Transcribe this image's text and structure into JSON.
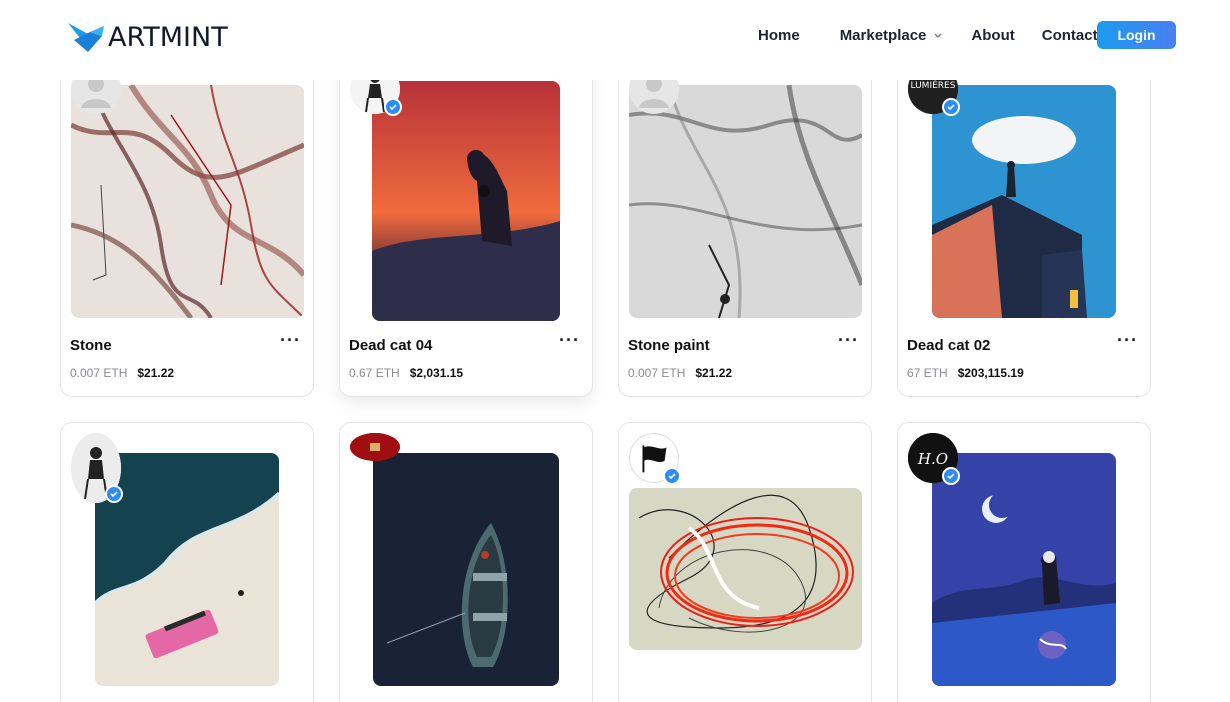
{
  "brand": {
    "name": "ARTMINT",
    "accent": "#1a9bf0"
  },
  "nav": {
    "home": "Home",
    "marketplace": "Marketplace",
    "about": "About",
    "contact": "Contact",
    "login": "Login"
  },
  "cards": [
    {
      "title": "Stone",
      "eth": "0.007 ETH",
      "usd": "$21.22",
      "more": "···"
    },
    {
      "title": "Dead cat 04",
      "eth": "0.67 ETH",
      "usd": "$2,031.15",
      "more": "···"
    },
    {
      "title": "Stone paint",
      "eth": "0.007 ETH",
      "usd": "$21.22",
      "more": "···"
    },
    {
      "title": "Dead cat 02",
      "eth": "67 ETH",
      "usd": "$203,115.19",
      "more": "···"
    }
  ],
  "avatars": {
    "card4": "LUMIÈRES",
    "card8": "H.O"
  }
}
